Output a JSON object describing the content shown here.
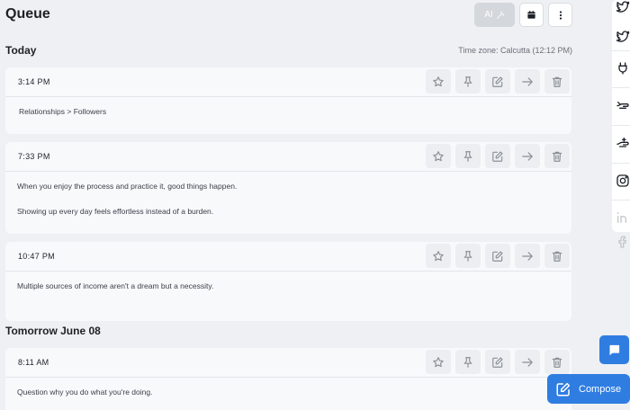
{
  "page": {
    "title": "Queue"
  },
  "header": {
    "ai_label": "AI",
    "ai_icon": "magic-wand-icon",
    "calendar_icon": "calendar-icon",
    "more_icon": "more-vertical-icon"
  },
  "timezone": "Time zone: Calcutta (12:12 PM)",
  "days": [
    {
      "heading": "Today",
      "posts": [
        {
          "time": "3:14 PM",
          "lines": [
            "Relationships > Followers"
          ]
        },
        {
          "time": "7:33 PM",
          "lines": [
            "When you enjoy the process and practice it, good things happen.",
            "Showing up every day feels effortless instead of a burden."
          ]
        },
        {
          "time": "10:47 PM",
          "lines": [
            "Multiple sources of income aren't a dream but a necessity."
          ]
        }
      ]
    },
    {
      "heading": "Tomorrow June 08",
      "posts": [
        {
          "time": "8:11 AM",
          "lines": [
            "Question why you do what you're doing."
          ]
        }
      ]
    }
  ],
  "post_actions": [
    "star-icon",
    "pin-icon",
    "edit-icon",
    "arrow-right-icon",
    "trash-icon"
  ],
  "rail_icons": [
    "twitter-icon",
    "twitter-icon",
    "threads-icon",
    "mastodon-icon",
    "mastodon-icon",
    "instagram-icon",
    "linkedin-icon",
    "facebook-icon"
  ],
  "compose": {
    "label": "Compose",
    "icon": "compose-icon"
  },
  "chat_icon": "chat-icon",
  "colors": {
    "accent": "#2f7de1",
    "background": "#eef0f3",
    "card": "#f8f9fb"
  }
}
